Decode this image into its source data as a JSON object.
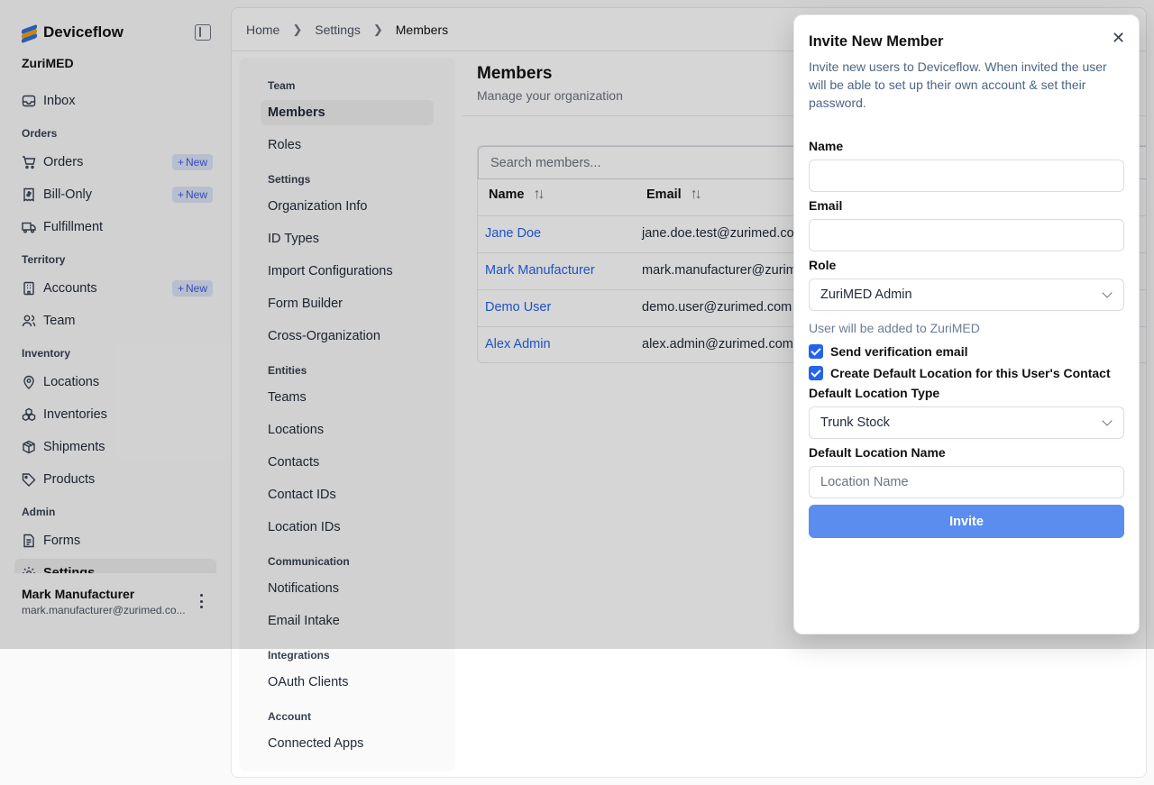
{
  "brand": {
    "name": "Deviceflow",
    "org": "ZuriMED"
  },
  "sidebar": {
    "items": [
      {
        "label": "Inbox"
      },
      {
        "section": "Orders"
      },
      {
        "label": "Orders",
        "badge": "New"
      },
      {
        "label": "Bill-Only",
        "badge": "New"
      },
      {
        "label": "Fulfillment"
      },
      {
        "section": "Territory"
      },
      {
        "label": "Accounts",
        "badge": "New"
      },
      {
        "label": "Team"
      },
      {
        "section": "Inventory"
      },
      {
        "label": "Locations"
      },
      {
        "label": "Inventories"
      },
      {
        "label": "Shipments"
      },
      {
        "label": "Products"
      },
      {
        "section": "Admin"
      },
      {
        "label": "Forms"
      },
      {
        "label": "Settings"
      }
    ],
    "user": {
      "name": "Mark Manufacturer",
      "email": "mark.manufacturer@zurimed.co..."
    }
  },
  "breadcrumb": [
    "Home",
    "Settings",
    "Members"
  ],
  "settings_nav": {
    "sections": {
      "team": "Team",
      "settings": "Settings",
      "entities": "Entities",
      "communication": "Communication",
      "integrations": "Integrations",
      "account": "Account"
    },
    "items": {
      "members": "Members",
      "roles": "Roles",
      "org_info": "Organization Info",
      "id_types": "ID Types",
      "import_configs": "Import Configurations",
      "form_builder": "Form Builder",
      "cross_org": "Cross-Organization",
      "teams": "Teams",
      "locations": "Locations",
      "contacts": "Contacts",
      "contact_ids": "Contact IDs",
      "location_ids": "Location IDs",
      "notifications": "Notifications",
      "email_intake": "Email Intake",
      "oauth_clients": "OAuth Clients",
      "connected_apps": "Connected Apps"
    }
  },
  "page": {
    "title": "Members",
    "subtitle": "Manage your organization"
  },
  "members_table": {
    "search_placeholder": "Search members...",
    "columns": [
      "Name",
      "Email"
    ],
    "rows": [
      {
        "name": "Jane Doe",
        "email": "jane.doe.test@zurimed.com"
      },
      {
        "name": "Mark Manufacturer",
        "email": "mark.manufacturer@zurimed.com"
      },
      {
        "name": "Demo User",
        "email": "demo.user@zurimed.com"
      },
      {
        "name": "Alex Admin",
        "email": "alex.admin@zurimed.com"
      }
    ]
  },
  "dialog": {
    "title": "Invite New Member",
    "description": "Invite new users to Deviceflow. When invited the user will be able to set up their own account & set their password.",
    "name_label": "Name",
    "name_value": "",
    "email_label": "Email",
    "email_value": "",
    "role_label": "Role",
    "role_value": "ZuriMED Admin",
    "hint": "User will be added to ZuriMED",
    "send_verification": {
      "label": "Send verification email",
      "checked": true
    },
    "create_default_location": {
      "label": "Create Default Location for this User's Contact",
      "checked": true
    },
    "location_type_label": "Default Location Type",
    "location_type_value": "Trunk Stock",
    "location_name_label": "Default Location Name",
    "location_name_placeholder": "Location Name",
    "invite_label": "Invite"
  },
  "colors": {
    "accent": "#2563eb",
    "invite_button": "#5b8def",
    "link": "#2563eb"
  }
}
